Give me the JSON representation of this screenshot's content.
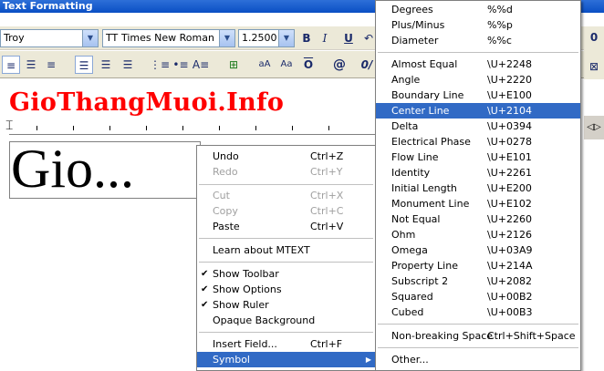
{
  "window": {
    "title": "Text Formatting"
  },
  "toolbar": {
    "style_value": "Troy",
    "font_icon": "TT",
    "font_value": "Times New Roman",
    "height_value": "1.2500",
    "bold_label": "B",
    "italic_label": "I",
    "underline_label": "U",
    "at_symbol": "@",
    "oblique_label": "0/"
  },
  "watermark": "GioThangMuoi.Info",
  "editor": {
    "text": "Gio..."
  },
  "context_menu": {
    "items": [
      {
        "label": "Undo",
        "shortcut": "Ctrl+Z",
        "enabled": true
      },
      {
        "label": "Redo",
        "shortcut": "Ctrl+Y",
        "enabled": false
      },
      {
        "label": "Cut",
        "shortcut": "Ctrl+X",
        "enabled": false
      },
      {
        "label": "Copy",
        "shortcut": "Ctrl+C",
        "enabled": false
      },
      {
        "label": "Paste",
        "shortcut": "Ctrl+V",
        "enabled": true
      },
      {
        "label": "Learn about MTEXT",
        "shortcut": "",
        "enabled": true
      },
      {
        "label": "Show Toolbar",
        "shortcut": "",
        "enabled": true,
        "checked": true
      },
      {
        "label": "Show Options",
        "shortcut": "",
        "enabled": true,
        "checked": true
      },
      {
        "label": "Show Ruler",
        "shortcut": "",
        "enabled": true,
        "checked": true
      },
      {
        "label": "Opaque Background",
        "shortcut": "",
        "enabled": true
      },
      {
        "label": "Insert Field...",
        "shortcut": "Ctrl+F",
        "enabled": true
      },
      {
        "label": "Symbol",
        "shortcut": "",
        "enabled": true,
        "highlighted": true,
        "submenu": true
      }
    ]
  },
  "symbol_menu": {
    "items": [
      {
        "label": "Degrees",
        "code": "%%d"
      },
      {
        "label": "Plus/Minus",
        "code": "%%p"
      },
      {
        "label": "Diameter",
        "code": "%%c"
      },
      {
        "label": "Almost Equal",
        "code": "\\U+2248"
      },
      {
        "label": "Angle",
        "code": "\\U+2220"
      },
      {
        "label": "Boundary Line",
        "code": "\\U+E100"
      },
      {
        "label": "Center Line",
        "code": "\\U+2104",
        "highlighted": true
      },
      {
        "label": "Delta",
        "code": "\\U+0394"
      },
      {
        "label": "Electrical Phase",
        "code": "\\U+0278"
      },
      {
        "label": "Flow Line",
        "code": "\\U+E101"
      },
      {
        "label": "Identity",
        "code": "\\U+2261"
      },
      {
        "label": "Initial Length",
        "code": "\\U+E200"
      },
      {
        "label": "Monument Line",
        "code": "\\U+E102"
      },
      {
        "label": "Not Equal",
        "code": "\\U+2260"
      },
      {
        "label": "Ohm",
        "code": "\\U+2126"
      },
      {
        "label": "Omega",
        "code": "\\U+03A9"
      },
      {
        "label": "Property Line",
        "code": "\\U+214A"
      },
      {
        "label": "Subscript 2",
        "code": "\\U+2082"
      },
      {
        "label": "Squared",
        "code": "\\U+00B2"
      },
      {
        "label": "Cubed",
        "code": "\\U+00B3"
      },
      {
        "label": "Non-breaking Space",
        "code": "Ctrl+Shift+Space"
      },
      {
        "label": "Other...",
        "code": ""
      }
    ]
  }
}
